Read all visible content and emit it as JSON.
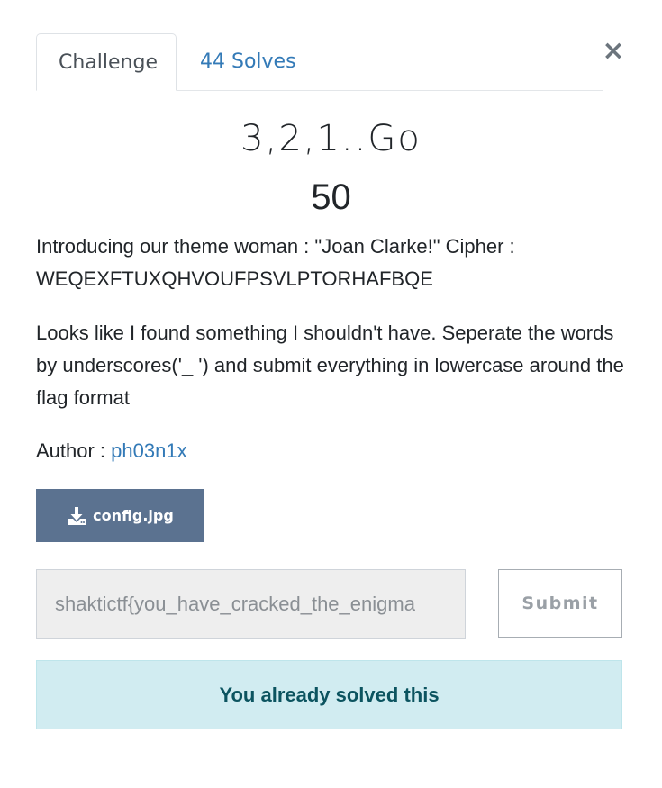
{
  "tabs": {
    "challenge_label": "Challenge",
    "solves_label": "44 Solves"
  },
  "close": {
    "symbol": "×"
  },
  "challenge": {
    "name": "3,2,1..Go",
    "points": "50",
    "description_p1": "Introducing our theme woman : \"Joan Clarke!\" Cipher : WEQEXFTUXQHVOUFPSVLPTORHAFBQE",
    "description_p2": "Looks like I found something I shouldn't have. Seperate the words by underscores('_ ') and submit everything in lowercase around the flag format",
    "author_prefix": "Author : ",
    "author_name": "ph03n1x"
  },
  "file": {
    "label": "config.jpg",
    "icon": "download-icon"
  },
  "flag": {
    "value": "shaktictf{you_have_cracked_the_enigma"
  },
  "submit": {
    "label": "Submit"
  },
  "alert": {
    "message": "You already solved this"
  },
  "colors": {
    "link": "#337ab7",
    "file_button": "#5b7290",
    "alert_bg": "#d1ecf1",
    "alert_text": "#0c5460"
  }
}
